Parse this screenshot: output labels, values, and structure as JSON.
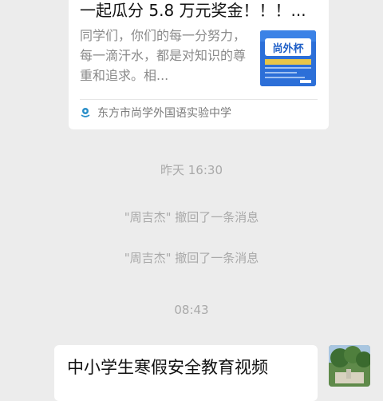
{
  "article_card": {
    "title": "一起瓜分 5.8 万元奖金！！！...",
    "description": "同学们，你们的每一分努力，每一滴汗水，都是对知识的尊重和追求。相...",
    "thumbnail_text": "尚外杯",
    "source_name": "东方市尚学外国语实验中学",
    "source_icon": "school-logo-icon"
  },
  "timeline": {
    "time_yesterday": "昨天 16:30",
    "recall_1": "\"周吉杰\" 撤回了一条消息",
    "recall_2": "\"周吉杰\" 撤回了一条消息",
    "time_today": "08:43"
  },
  "video_card": {
    "title": "中小学生寒假安全教育视频"
  },
  "colors": {
    "chat_background": "#ececec",
    "card_background": "#ffffff",
    "system_text": "#a9a9a9",
    "thumbnail_blue": "#2c6fd8",
    "source_icon_blue": "#2a8fc9"
  }
}
